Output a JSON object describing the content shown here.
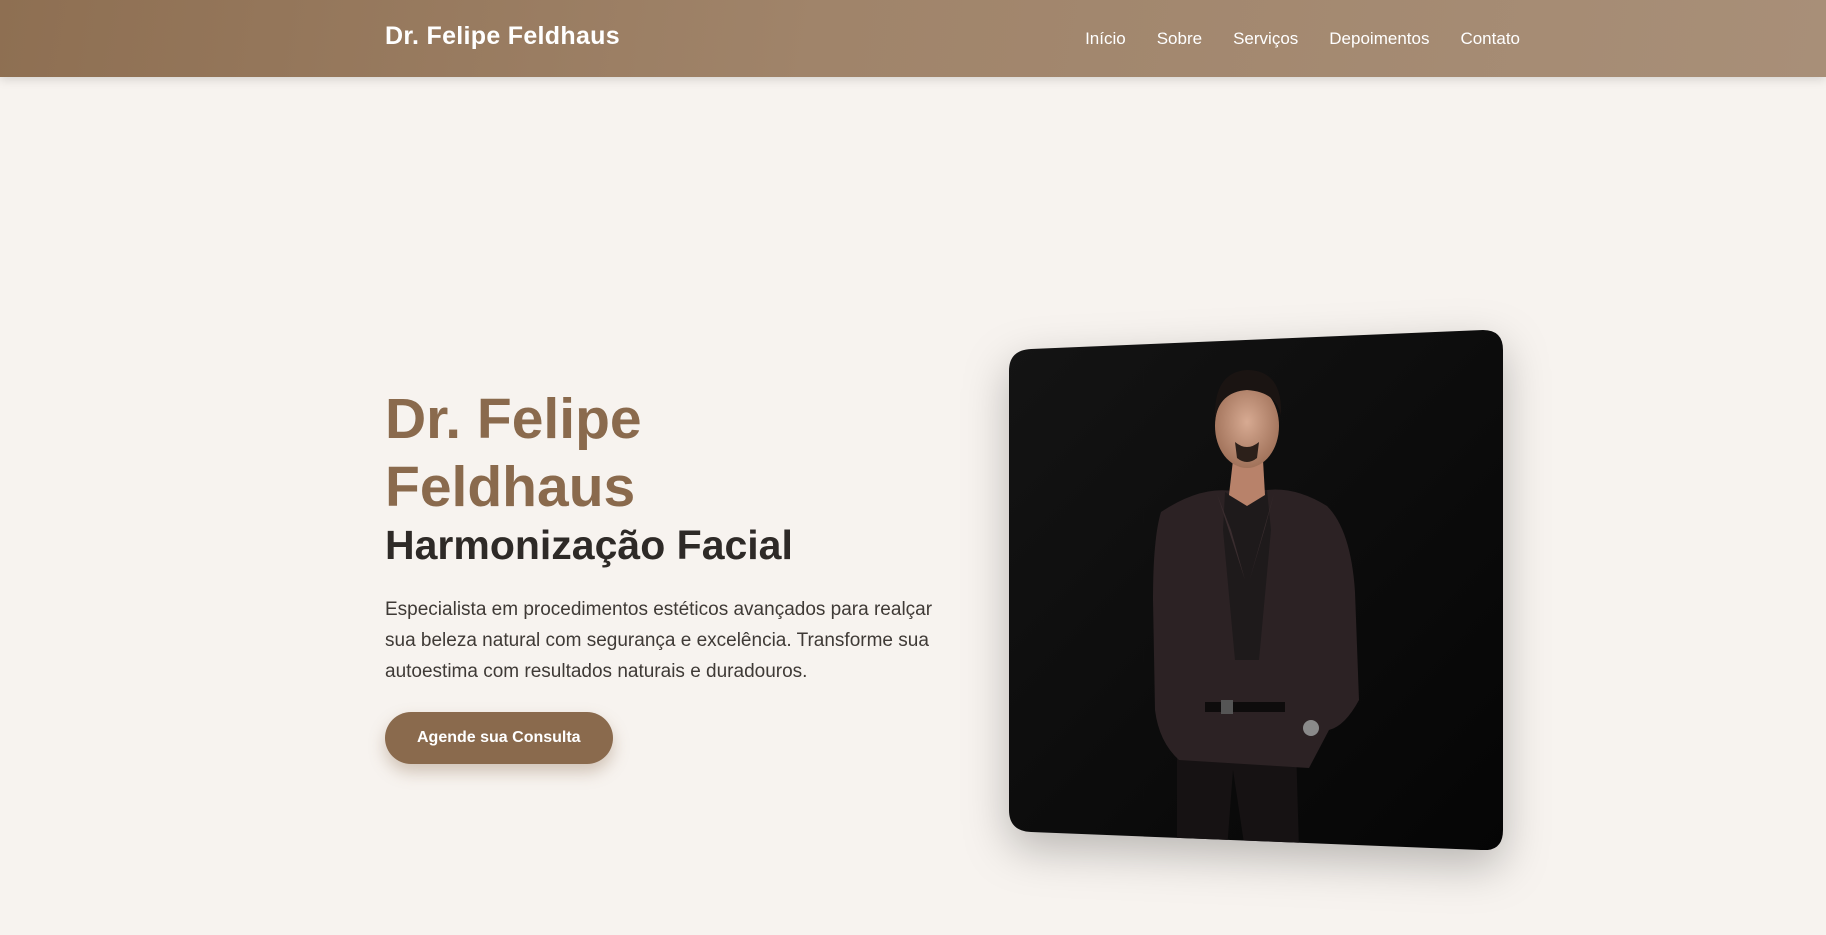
{
  "nav": {
    "brand": "Dr. Felipe Feldhaus",
    "links": [
      "Início",
      "Sobre",
      "Serviços",
      "Depoimentos",
      "Contato"
    ]
  },
  "hero": {
    "name_line1": "Dr. Felipe",
    "name_line2": "Feldhaus",
    "subtitle": "Harmonização Facial",
    "description": "Especialista em procedimentos estéticos avançados para realçar sua beleza natural com segurança e excelência. Transforme sua autoestima com resultados naturais e duradouros.",
    "cta_label": "Agende sua Consulta"
  },
  "colors": {
    "accent": "#8a6a4d",
    "nav_bg": "#a0846a",
    "page_bg": "#f7f3ef",
    "heading_dark": "#2e2a27"
  },
  "photo": {
    "icon": "doctor-portrait-photo"
  }
}
